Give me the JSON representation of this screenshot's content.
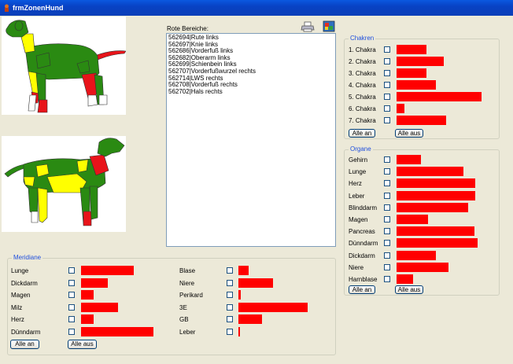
{
  "window": {
    "title": "frmZonenHund"
  },
  "rote_bereiche": {
    "label": "Rote Bereiche:",
    "items": [
      "562694|Rute links",
      "562697|Knie links",
      "562686|Vorderfuß links",
      "562682|Oberarm links",
      "562699|Schienbein links",
      "562707|Vorderfußwurzel rechts",
      "562714|LWS rechts",
      "562708|Vorderfuß rechts",
      "562702|Hals rechts"
    ]
  },
  "toolbar": {
    "print_icon": "printer-icon",
    "image_icon": "image-icon"
  },
  "chakren": {
    "title": "Chakren",
    "items": [
      {
        "label": "1. Chakra",
        "value": 38
      },
      {
        "label": "2. Chakra",
        "value": 60
      },
      {
        "label": "3. Chakra",
        "value": 38
      },
      {
        "label": "4. Chakra",
        "value": 50
      },
      {
        "label": "5. Chakra",
        "value": 108
      },
      {
        "label": "6. Chakra",
        "value": 10
      },
      {
        "label": "7. Chakra",
        "value": 63
      }
    ],
    "all_on": "Alle an",
    "all_off": "Alle aus"
  },
  "organe": {
    "title": "Organe",
    "items": [
      {
        "label": "Gehirn",
        "value": 31
      },
      {
        "label": "Lunge",
        "value": 85
      },
      {
        "label": "Herz",
        "value": 100
      },
      {
        "label": "Leber",
        "value": 100
      },
      {
        "label": "Blinddarm",
        "value": 91
      },
      {
        "label": "Magen",
        "value": 40
      },
      {
        "label": "Pancreas",
        "value": 99
      },
      {
        "label": "Dünndarm",
        "value": 103
      },
      {
        "label": "Dickdarm",
        "value": 50
      },
      {
        "label": "Niere",
        "value": 66
      },
      {
        "label": "Harnblase",
        "value": 21
      }
    ],
    "all_on": "Alle an",
    "all_off": "Alle aus"
  },
  "meridiane": {
    "title": "Meridiane",
    "left": [
      {
        "label": "Lunge",
        "value": 67
      },
      {
        "label": "Dickdarm",
        "value": 34
      },
      {
        "label": "Magen",
        "value": 16
      },
      {
        "label": "Milz",
        "value": 47
      },
      {
        "label": "Herz",
        "value": 16
      },
      {
        "label": "Dünndarm",
        "value": 92
      }
    ],
    "right": [
      {
        "label": "Blase",
        "value": 13
      },
      {
        "label": "Niere",
        "value": 44
      },
      {
        "label": "Perikard",
        "value": 3
      },
      {
        "label": "3E",
        "value": 88
      },
      {
        "label": "GB",
        "value": 30
      },
      {
        "label": "Leber",
        "value": 2
      }
    ],
    "all_on": "Alle an",
    "all_off": "Alle aus"
  },
  "colors": {
    "bar": "#ff0000",
    "zone_green": "#2a8a12",
    "zone_yellow": "#ffff00",
    "zone_red": "#e8141a",
    "group_title": "#1f4fdd"
  }
}
